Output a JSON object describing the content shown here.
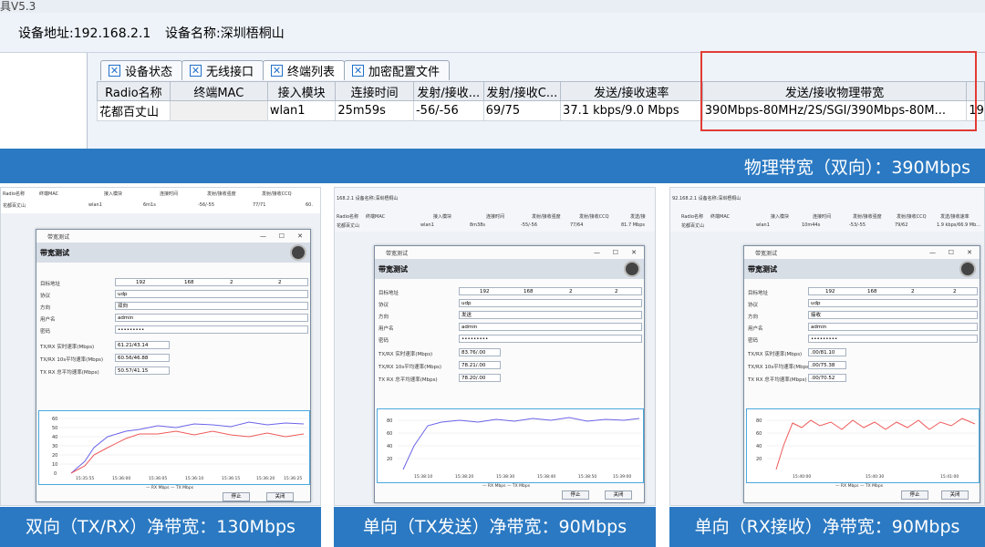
{
  "app": {
    "title": "具V5.3"
  },
  "device": {
    "address": "设备地址:192.168.2.1",
    "name": "设备名称:深圳梧桐山"
  },
  "tabs": [
    "设备状态",
    "无线接口",
    "终端列表",
    "加密配置文件"
  ],
  "table": {
    "headers": [
      "Radio名称",
      "终端MAC",
      "接入模块",
      "连接时间",
      "发射/接收...",
      "发射/接收C...",
      "发送/接收速率",
      "发送/接收物理带宽"
    ],
    "row": [
      "花都百丈山",
      "",
      "wlan1",
      "25m59s",
      "-56/-56",
      "69/75",
      "37.1 kbps/9.0 Mbps",
      "390Mbps-80MHz/2S/SGI/390Mbps-80M..."
    ],
    "overflow": "19"
  },
  "banner_top": "物理带宽（双向）：390Mbps",
  "panels": [
    {
      "bg_header": [
        "Radio名称",
        "终端MAC",
        "接入模块",
        "连接时间",
        "发射/接收强度",
        "发射/接收CCQ"
      ],
      "bg_row": [
        "花都百丈山",
        "wlan1",
        "6m1s",
        "-56/-55",
        "77/71",
        "60."
      ],
      "dialog_title": "带宽测试",
      "header": "带宽测试",
      "labels": [
        "目标地址",
        "协议",
        "方向",
        "用户名",
        "密码",
        "TX/RX 实时速率(Mbps)",
        "TX/RX 10s平均速率(Mbps)",
        "TX RX 总平均速率(Mbps)"
      ],
      "ip": [
        "192",
        "168",
        "2",
        "2"
      ],
      "protocol": "udp",
      "direction": "双向",
      "user": "admin",
      "password": "•••••••••",
      "rates": [
        "61.21/43.14",
        "60.56/46.88",
        "50.57/41.15"
      ],
      "chart_y": [
        "60",
        "50",
        "40",
        "30",
        "20",
        "10",
        "0"
      ],
      "chart_x": [
        "15:35:55",
        "15:36:00",
        "15:36:05",
        "15:36:10",
        "15:36:15",
        "15:36:20",
        "15:36:25"
      ],
      "legend": "— RX Mbps — TX Mbps",
      "buttons": [
        "停止",
        "关闭"
      ],
      "caption": "双向（TX/RX）净带宽：130Mbps"
    },
    {
      "bg_info": "168.2.1   设备名称:深圳梧桐山",
      "bg_header": [
        "Radio名称",
        "终端MAC",
        "接入模块",
        "连接时间",
        "发射/接收强度",
        "发射/接收CCQ",
        "发送/接"
      ],
      "bg_row": [
        "花都百丈山",
        "wlan1",
        "8m38s",
        "-55/-56",
        "77/64",
        "81.7 Mbps"
      ],
      "dialog_title": "带宽测试",
      "header": "带宽测试",
      "labels": [
        "目标地址",
        "协议",
        "方向",
        "用户名",
        "密码",
        "TX/RX 实时速率(Mbps)",
        "TX/RX 10s平均速率(Mbps)",
        "TX RX 总平均速率(Mbps)"
      ],
      "ip": [
        "192",
        "168",
        "2",
        "2"
      ],
      "protocol": "udp",
      "direction": "发送",
      "user": "admin",
      "password": "•••••••••",
      "rates": [
        "83.76/.00",
        "78.21/.00",
        "78.20/.00"
      ],
      "chart_y": [
        "80",
        "60",
        "40",
        "20"
      ],
      "chart_x": [
        "15:38:10",
        "15:38:20",
        "15:38:30",
        "15:38:40",
        "15:38:50",
        "15:39:00"
      ],
      "legend": "— RX Mbps — TX Mbps",
      "buttons": [
        "停止",
        "关闭"
      ],
      "caption": "单向（TX发送）净带宽：90Mbps"
    },
    {
      "bg_info": "92.168.2.1   设备名称:深圳梧桐山",
      "bg_header": [
        "Radio名称",
        "终端MAC",
        "接入模块",
        "连接时间",
        "发射/接收强度",
        "发射/接收CCQ",
        "发送/接收速率"
      ],
      "bg_row": [
        "花都百丈山",
        "wlan1",
        "10m44s",
        "-53/-55",
        "79/62",
        "1.9 kbps/66.9 Mb..."
      ],
      "dialog_title": "带宽测试",
      "header": "带宽测试",
      "labels": [
        "目标地址",
        "协议",
        "方向",
        "用户名",
        "密码",
        "TX/RX 实时速率(Mbps)",
        "TX/RX 10s平均速率(Mbps)",
        "TX RX 总平均速率(Mbps)"
      ],
      "ip": [
        "192",
        "168",
        "2",
        "2"
      ],
      "protocol": "udp",
      "direction": "接收",
      "user": "admin",
      "password": "•••••••••",
      "rates": [
        ".00/81.10",
        ".00/75.38",
        ".00/70.52"
      ],
      "chart_y": [
        "80",
        "60",
        "40",
        "20"
      ],
      "chart_x": [
        "15:40:00",
        "15:40:30",
        "15:41:00"
      ],
      "legend": "— RX Mbps — TX Mbps",
      "buttons": [
        "停止",
        "关闭"
      ],
      "caption": "单向（RX接收）净带宽：90Mbps"
    }
  ],
  "colors": {
    "banner": "#2b79c2",
    "highlight": "#e23b35",
    "rx_line": "#6b63e8",
    "tx_line": "#ef5a5a"
  }
}
